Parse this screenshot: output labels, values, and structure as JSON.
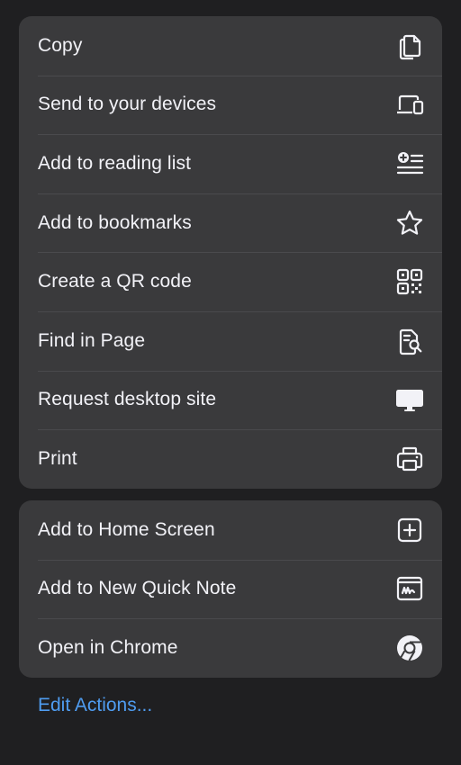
{
  "group1": {
    "items": [
      {
        "label": "Copy",
        "icon": "copy-icon"
      },
      {
        "label": "Send to your devices",
        "icon": "devices-icon"
      },
      {
        "label": "Add to reading list",
        "icon": "reading-list-icon"
      },
      {
        "label": "Add to bookmarks",
        "icon": "star-icon"
      },
      {
        "label": "Create a QR code",
        "icon": "qr-code-icon"
      },
      {
        "label": "Find in Page",
        "icon": "find-in-page-icon"
      },
      {
        "label": "Request desktop site",
        "icon": "desktop-icon"
      },
      {
        "label": "Print",
        "icon": "printer-icon"
      }
    ]
  },
  "group2": {
    "items": [
      {
        "label": "Add to Home Screen",
        "icon": "add-square-icon"
      },
      {
        "label": "Add to New Quick Note",
        "icon": "quick-note-icon"
      },
      {
        "label": "Open in Chrome",
        "icon": "chrome-icon"
      }
    ]
  },
  "footer": {
    "edit_actions_label": "Edit Actions..."
  },
  "colors": {
    "background": "#1f1f21",
    "panel": "#3a3a3c",
    "text": "#f2f2f7",
    "link": "#4f9cf0"
  }
}
